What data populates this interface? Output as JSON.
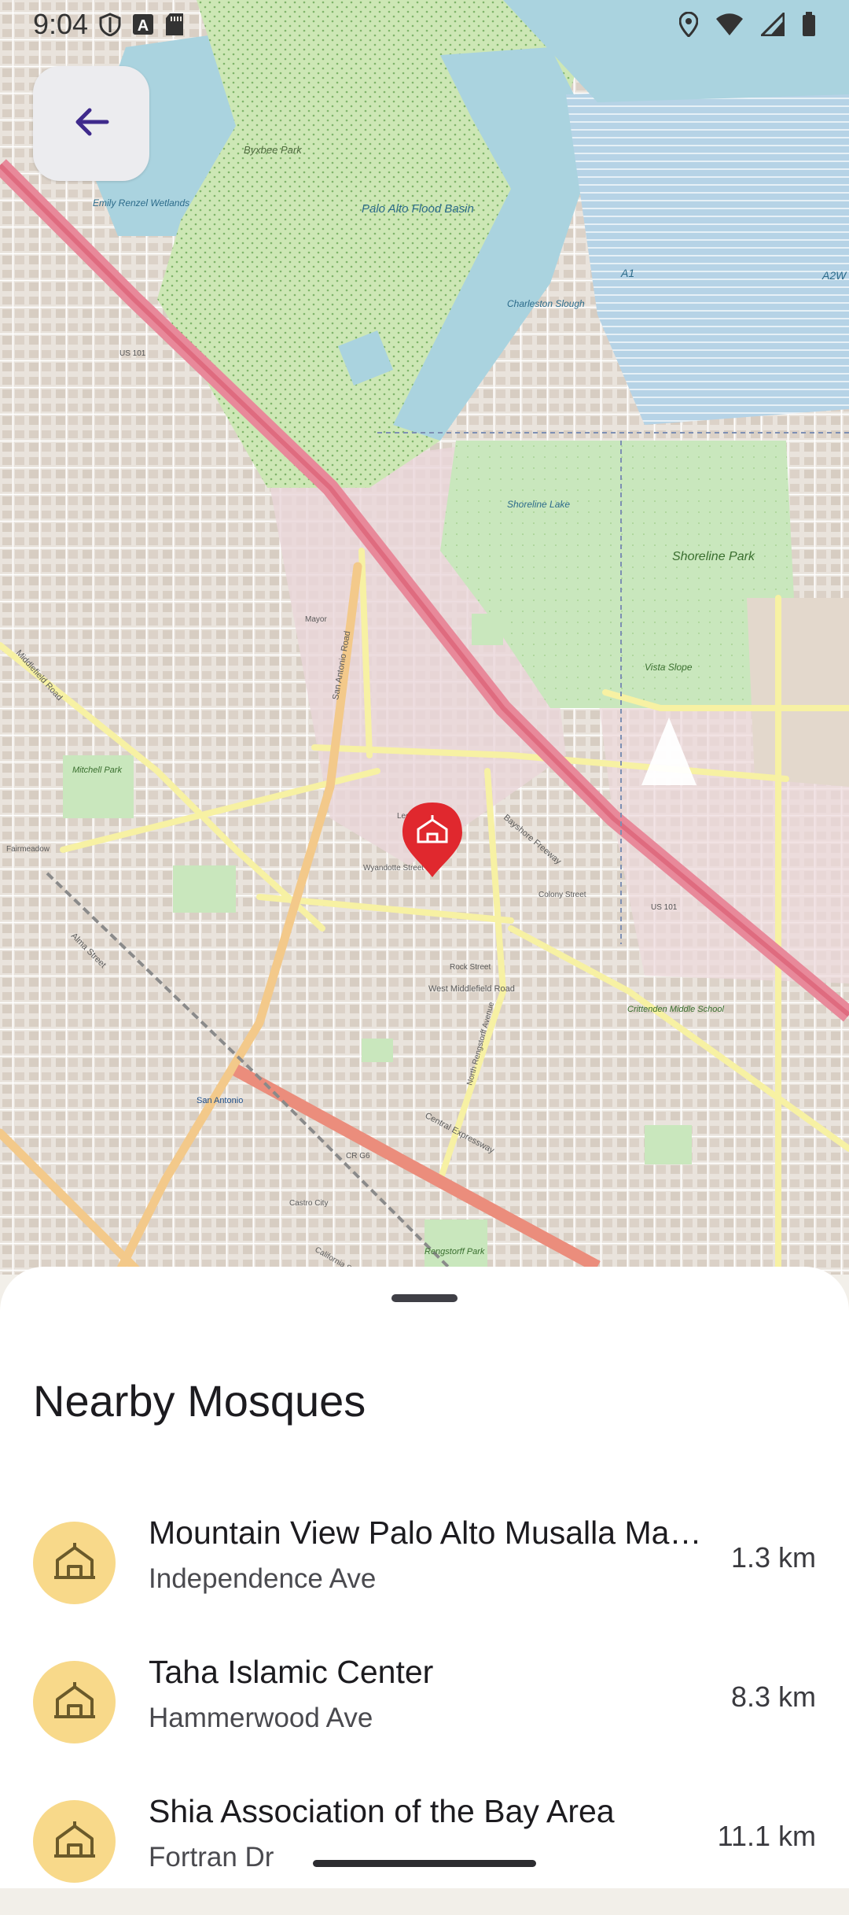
{
  "status_bar": {
    "time": "9:04",
    "left_icons": [
      "shield-icon",
      "font-app-icon",
      "sd-card-icon"
    ],
    "right_icons": [
      "location-icon",
      "wifi-icon",
      "signal-icon",
      "battery-icon"
    ]
  },
  "back_button": {
    "icon": "arrow-back-icon"
  },
  "map": {
    "selected_marker_icon": "mosque-icon",
    "marker_color": "#e0282e",
    "labels": {
      "byxbee_park": "Byxbee Park",
      "emily_renzel": "Emily Renzel Wetlands",
      "palo_alto_flood_basin": "Palo Alto Flood Basin",
      "charleston_slough": "Charleston Slough",
      "a1": "A1",
      "a2w": "A2W",
      "shoreline_lake": "Shoreline Lake",
      "shoreline_park": "Shoreline Park",
      "vista_slope": "Vista Slope",
      "us101_a": "US 101",
      "us101_b": "US 101",
      "bayshore_freeway": "Bayshore Freeway",
      "middlefield_road": "Middlefield Road",
      "west_middlefield_road": "West Middlefield Road",
      "san_antonio_road": "San Antonio Road",
      "leghorn_street": "Leghorn Street",
      "wyandotte_street": "Wyandotte Street",
      "colony_street": "Colony Street",
      "rock_street": "Rock Street",
      "central_expressway": "Central Expressway",
      "alma_street": "Alma Street",
      "san_antonio": "San Antonio",
      "mitchell_park": "Mitchell Park",
      "fairmeadow": "Fairmeadow",
      "crittenden_middle_school": "Crittenden Middle School",
      "rengstorff_park": "Rengstorff Park",
      "cr_g6": "CR G6",
      "castro_city": "Castro City",
      "mayor": "Mayor",
      "north_rengstorff": "North Rengstorff Avenue",
      "california_street": "California Street"
    }
  },
  "sheet": {
    "title": "Nearby Mosques",
    "items": [
      {
        "name": "Mountain View Palo Alto Musalla Masjid",
        "street": "Independence Ave",
        "distance": "1.3 km",
        "icon": "mosque-icon"
      },
      {
        "name": "Taha Islamic Center",
        "street": "Hammerwood Ave",
        "distance": "8.3 km",
        "icon": "mosque-icon"
      },
      {
        "name": "Shia Association of the Bay Area",
        "street": "Fortran Dr",
        "distance": "11.1 km",
        "icon": "mosque-icon"
      }
    ]
  },
  "colors": {
    "avatar_bg": "#f8d98a",
    "accent": "#3f2a8c",
    "marker": "#e0282e"
  }
}
